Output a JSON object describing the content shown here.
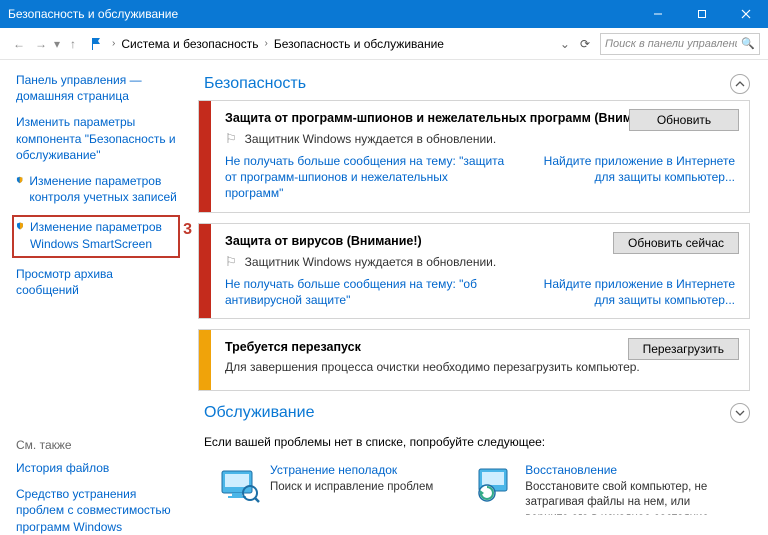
{
  "title": "Безопасность и обслуживание",
  "breadcrumb": {
    "item1": "Система и безопасность",
    "item2": "Безопасность и обслуживание"
  },
  "search_placeholder": "Поиск в панели управления",
  "sidebar": {
    "home": "Панель управления — домашняя страница",
    "change_params": "Изменить параметры компонента \"Безопасность и обслуживание\"",
    "uac": "Изменение параметров контроля учетных записей",
    "smartscreen": "Изменение параметров Windows SmartScreen",
    "archive": "Просмотр архива сообщений",
    "callout": "3",
    "see_also": "См. также",
    "file_history": "История файлов",
    "troubleshoot": "Средство устранения проблем с совместимостью программ Windows"
  },
  "security": {
    "header": "Безопасность",
    "card1": {
      "title": "Защита от программ-шпионов и нежелательных программ  (Внимание!)",
      "msg": "Защитник Windows нуждается в обновлении.",
      "link_left": "Не получать больше сообщения на тему: \"защита от программ-шпионов и нежелательных программ\"",
      "link_right": "Найдите приложение в Интернете для защиты компьютер...",
      "btn": "Обновить"
    },
    "card2": {
      "title": "Защита от вирусов  (Внимание!)",
      "msg": "Защитник Windows нуждается в обновлении.",
      "link_left": "Не получать больше сообщения на тему: \"об антивирусной защите\"",
      "link_right": "Найдите приложение в Интернете для защиты компьютер...",
      "btn": "Обновить сейчас"
    },
    "card3": {
      "title": "Требуется перезапуск",
      "msg": "Для завершения процесса очистки необходимо перезагрузить компьютер.",
      "btn": "Перезагрузить"
    }
  },
  "maintenance": {
    "header": "Обслуживание"
  },
  "help_text": "Если вашей проблемы нет в списке, попробуйте следующее:",
  "tiles": {
    "troubleshoot": {
      "title": "Устранение неполадок",
      "desc": "Поиск и исправление проблем"
    },
    "recovery": {
      "title": "Восстановление",
      "desc": "Восстановите свой компьютер, не затрагивая файлы на нем, или верните его в исходное состояние."
    }
  }
}
